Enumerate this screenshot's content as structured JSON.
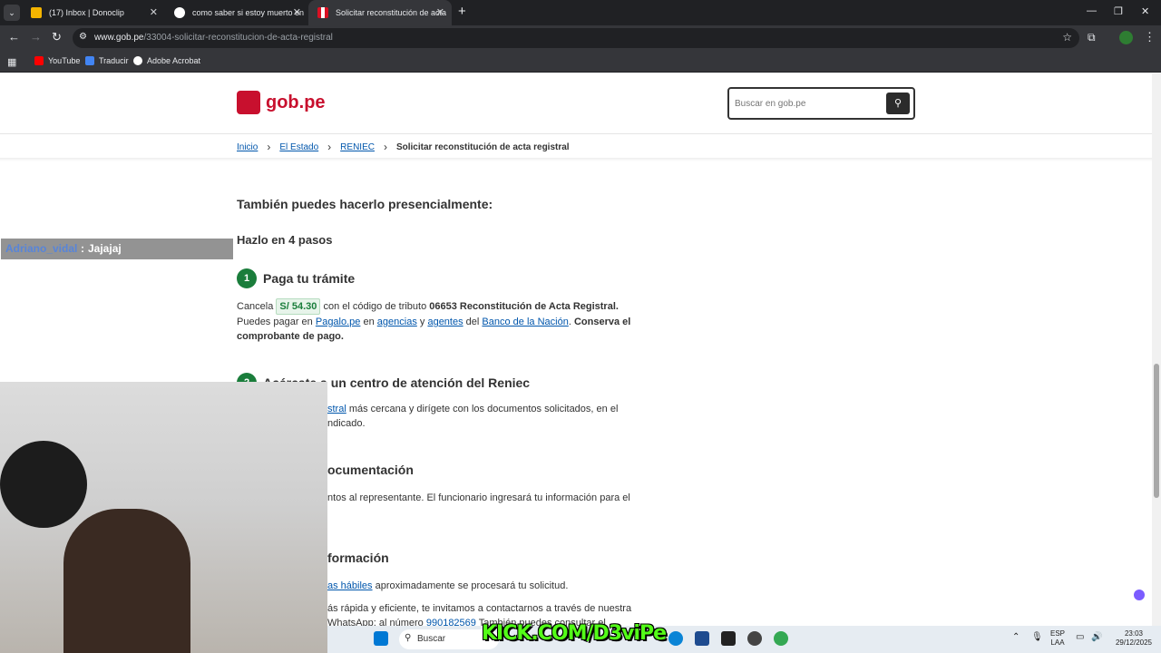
{
  "browser": {
    "tabs": [
      {
        "label": "(17) Inbox | Donoclip",
        "active": false
      },
      {
        "label": "como saber si estoy muerto en",
        "active": false
      },
      {
        "label": "Solicitar reconstitución de acta",
        "active": true
      }
    ],
    "url_domain": "www.gob.pe",
    "url_path": "/33004-solicitar-reconstitucion-de-acta-registral",
    "bookmarks": [
      "YouTube",
      "Traducir",
      "Adobe Acrobat"
    ]
  },
  "site": {
    "logo_text": "gob.pe",
    "search_placeholder": "Buscar en gob.pe"
  },
  "breadcrumb": {
    "items": [
      "Inicio",
      "El Estado",
      "RENIEC"
    ],
    "current": "Solicitar reconstitución de acta registral"
  },
  "content": {
    "heading1": "También puedes hacerlo presencialmente:",
    "heading2": "Hazlo en 4 pasos",
    "step1": {
      "num": "1",
      "title": "Paga tu trámite",
      "p1_a": "Cancela",
      "price": "S/ 54.30",
      "p1_b": "con el código de tributo",
      "p1_c": "06653 Reconstitución de Acta Registral.",
      "p2_a": "Puedes pagar en",
      "link_pagalo": "Pagalo.pe",
      "p2_b": "en",
      "link_agencias": "agencias",
      "p2_c": "y",
      "link_agentes": "agentes",
      "p2_d": "del",
      "link_banco": "Banco de la Nación",
      "p2_e": "Conserva el comprobante de pago."
    },
    "step2": {
      "num": "2",
      "title": "Acércate a un centro de atención del Reniec",
      "p_link": "stral",
      "p_a": "más cercana y dirígete con los documentos solicitados, en el",
      "p_b": "ndicado."
    },
    "step3_title": "ocumentación",
    "step3_text": "ntos al representante. El funcionario ingresará tu información para el",
    "step4_title": "formación",
    "step4_link": "as hábiles",
    "step4_text": "aproximadamente se procesará tu solicitud.",
    "step4_text2": "ás rápida y eficiente, te invitamos a contactarnos a través de nuestra",
    "step4_text3a": "WhatsApp: al número",
    "step4_phone": "990182569",
    "step4_text3b": "También puedes consultar el"
  },
  "stream": {
    "chat_user": "Adriano_vidal",
    "chat_sep": ":",
    "chat_msg": "Jajajaj",
    "kick_prefix": "K",
    "kick_text": "KICK.COM/D3viPe"
  },
  "taskbar": {
    "search_label": "Buscar",
    "lang_top": "ESP",
    "lang_bottom": "LAA",
    "time": "23:03",
    "date": "29/12/2025"
  }
}
